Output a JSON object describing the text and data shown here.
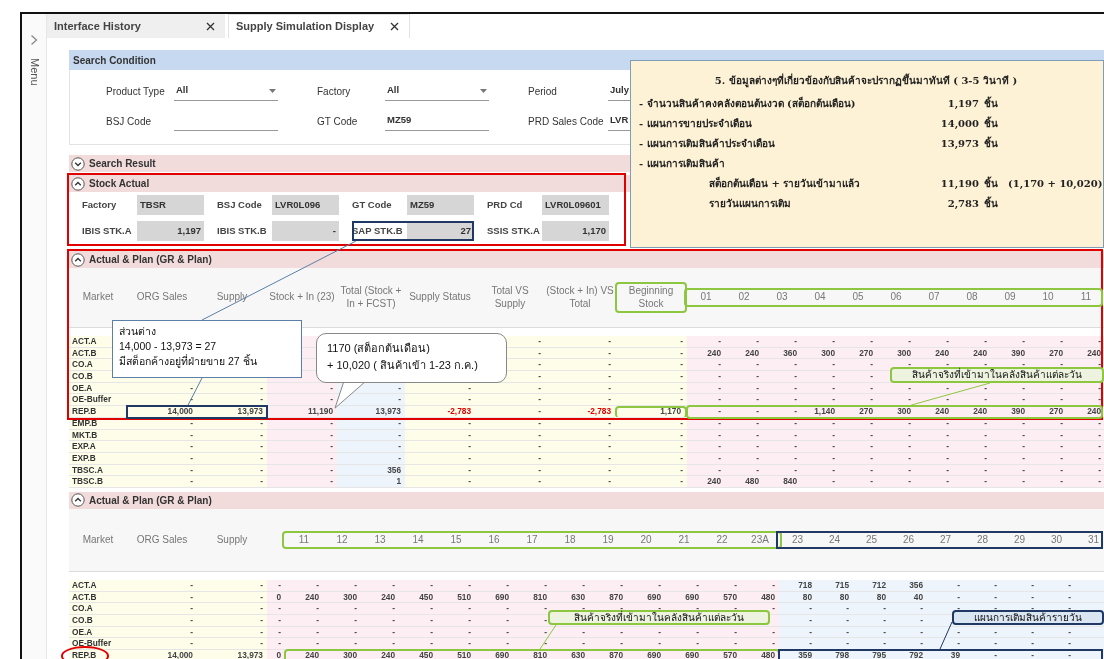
{
  "sidebar": {
    "menu_label": "Menu"
  },
  "tabs": [
    {
      "label": "Interface History",
      "selected": false
    },
    {
      "label": "Supply Simulation Display",
      "selected": true
    }
  ],
  "search_condition": {
    "title": "Search Condition",
    "fields": [
      {
        "label": "Product Type",
        "kind": "select",
        "value": "All"
      },
      {
        "label": "Factory",
        "kind": "select",
        "value": "All"
      },
      {
        "label": "Period",
        "kind": "text",
        "value": "July"
      },
      {
        "label": "BSJ Code",
        "kind": "text"
      },
      {
        "label": "GT Code",
        "kind": "text",
        "value": "MZ59"
      },
      {
        "label": "PRD Sales Code",
        "kind": "text",
        "value": "LVR"
      }
    ]
  },
  "search_result": {
    "title": "Search Result",
    "expanded": false
  },
  "stock_actual": {
    "title": "Stock Actual",
    "expanded": true,
    "fields": [
      {
        "label": "Factory",
        "kind": "code",
        "value": "TBSR"
      },
      {
        "label": "BSJ Code",
        "kind": "code",
        "value": "LVR0L096"
      },
      {
        "label": "GT Code",
        "kind": "code",
        "value": "MZ59"
      },
      {
        "label": "PRD Cd",
        "kind": "code",
        "value": "LVR0L09601"
      },
      {
        "label": "IBIS STK.A",
        "kind": "number",
        "value": "1,197"
      },
      {
        "label": "IBIS STK.B",
        "kind": "number",
        "value": "-"
      },
      {
        "label": "SAP STK.B",
        "kind": "number",
        "value": "27"
      },
      {
        "label": "SSIS STK.A",
        "kind": "number",
        "value": "1,170"
      }
    ]
  },
  "plan_tables": [
    {
      "title": "Actual & Plan (GR & Plan)",
      "expanded": true,
      "columns": [
        {
          "label": "Market",
          "kind": "market"
        },
        {
          "label": "ORG Sales",
          "kind": "number"
        },
        {
          "label": "Supply",
          "kind": "number"
        },
        {
          "label": "Stock + In (23)",
          "kind": "stock"
        },
        {
          "label": "Total (Stock + In + FCST)",
          "kind": "total"
        },
        {
          "label": "Supply Status",
          "kind": "number"
        },
        {
          "label": "Total VS Supply",
          "kind": "number"
        },
        {
          "label": "(Stock + In) VS Total",
          "kind": "number"
        },
        {
          "label": "Beginning Stock",
          "kind": "begin"
        },
        {
          "label": "01",
          "kind": "day"
        },
        {
          "label": "02",
          "kind": "day"
        },
        {
          "label": "03",
          "kind": "day"
        },
        {
          "label": "04",
          "kind": "day"
        },
        {
          "label": "05",
          "kind": "day"
        },
        {
          "label": "06",
          "kind": "day"
        },
        {
          "label": "07",
          "kind": "day"
        },
        {
          "label": "08",
          "kind": "day"
        },
        {
          "label": "09",
          "kind": "day"
        },
        {
          "label": "10",
          "kind": "day"
        },
        {
          "label": "11",
          "kind": "day"
        }
      ],
      "rows": [
        {
          "cells": [
            "ACT.A",
            null,
            null,
            null,
            null,
            null,
            "-",
            "-",
            "-",
            "-",
            "-",
            "-",
            "-",
            "-",
            "-",
            "-",
            "-",
            "-",
            "-",
            "-"
          ]
        },
        {
          "cells": [
            "ACT.B",
            null,
            null,
            null,
            null,
            null,
            "-",
            "-",
            "-",
            "240",
            "240",
            "360",
            "300",
            "270",
            "300",
            "240",
            "240",
            "390",
            "270",
            "240"
          ]
        },
        {
          "cells": [
            "CO.A",
            null,
            null,
            null,
            null,
            null,
            "-",
            "-",
            "-",
            "-",
            "-",
            "-",
            "-",
            "-",
            "-",
            "-",
            "-",
            "-",
            "-",
            "-"
          ]
        },
        {
          "cells": [
            "CO.B",
            null,
            null,
            null,
            null,
            null,
            "-",
            "-",
            "-",
            "-",
            "-",
            "-",
            "-",
            "-",
            null,
            null,
            null,
            null,
            null,
            null
          ]
        },
        {
          "cells": [
            "OE.A",
            "-",
            "-",
            "-",
            "-",
            "-",
            "-",
            "-",
            "-",
            "-",
            "-",
            "-",
            "-",
            "-",
            "-",
            "-",
            "-",
            "-",
            "-",
            "-"
          ]
        },
        {
          "cells": [
            "OE-Buffer",
            "-",
            "-",
            "-",
            "-",
            "-",
            "-",
            "-",
            "-",
            "-",
            "-",
            "-",
            "-",
            "-",
            "-",
            "-",
            "-",
            "-",
            "-",
            "-"
          ]
        },
        {
          "cells": [
            "REP.B",
            "14,000",
            "13,973",
            "11,190",
            "13,973",
            {
              "text": "-2,783",
              "alert": true
            },
            "-",
            {
              "text": "-2,783",
              "alert": true
            },
            "1,170",
            "-",
            "-",
            "-",
            "1,140",
            "270",
            "300",
            "240",
            "240",
            "390",
            "270",
            "240"
          ]
        },
        {
          "cells": [
            "EMP.B",
            "-",
            "-",
            "-",
            "-",
            "-",
            "-",
            "-",
            "-",
            "-",
            "-",
            "-",
            "-",
            "-",
            "-",
            "-",
            "-",
            "-",
            "-",
            "-"
          ]
        },
        {
          "cells": [
            "MKT.B",
            "-",
            "-",
            "-",
            "-",
            "-",
            "-",
            "-",
            "-",
            "-",
            "-",
            "-",
            "-",
            "-",
            "-",
            "-",
            "-",
            "-",
            "-",
            "-"
          ]
        },
        {
          "cells": [
            "EXP.A",
            "-",
            "-",
            "-",
            "-",
            "-",
            "-",
            "-",
            "-",
            "-",
            "-",
            "-",
            "-",
            "-",
            "-",
            "-",
            "-",
            "-",
            "-",
            "-"
          ]
        },
        {
          "cells": [
            "EXP.B",
            "-",
            "-",
            "-",
            "-",
            "-",
            "-",
            "-",
            "-",
            "-",
            "-",
            "-",
            "-",
            "-",
            "-",
            "-",
            "-",
            "-",
            "-",
            "-"
          ]
        },
        {
          "cells": [
            "TBSC.A",
            "-",
            "-",
            "-",
            "356",
            "-",
            "-",
            "-",
            "-",
            "-",
            "-",
            "-",
            "-",
            "-",
            "-",
            "-",
            "-",
            "-",
            "-",
            "-"
          ]
        },
        {
          "cells": [
            "TBSC.B",
            "-",
            "-",
            "-",
            "1",
            "-",
            "-",
            "-",
            "-",
            "240",
            "480",
            "840",
            "-",
            "-",
            "-",
            "-",
            "-",
            "-",
            "-",
            "-"
          ]
        }
      ]
    },
    {
      "title": "Actual & Plan (GR & Plan)",
      "expanded": true,
      "columns": [
        {
          "label": "Market",
          "kind": "market"
        },
        {
          "label": "ORG Sales",
          "kind": "number"
        },
        {
          "label": "Supply",
          "kind": "number"
        },
        {
          "kind": "partial"
        },
        {
          "label": "11",
          "kind": "day"
        },
        {
          "label": "12",
          "kind": "day"
        },
        {
          "label": "13",
          "kind": "day"
        },
        {
          "label": "14",
          "kind": "day"
        },
        {
          "label": "15",
          "kind": "day"
        },
        {
          "label": "16",
          "kind": "day"
        },
        {
          "label": "17",
          "kind": "day"
        },
        {
          "label": "18",
          "kind": "day"
        },
        {
          "label": "19",
          "kind": "day"
        },
        {
          "label": "20",
          "kind": "day"
        },
        {
          "label": "21",
          "kind": "day"
        },
        {
          "label": "22",
          "kind": "day"
        },
        {
          "label": "23A",
          "kind": "day"
        },
        {
          "label": "23",
          "kind": "plan"
        },
        {
          "label": "24",
          "kind": "plan"
        },
        {
          "label": "25",
          "kind": "plan"
        },
        {
          "label": "26",
          "kind": "plan"
        },
        {
          "label": "27",
          "kind": "plan"
        },
        {
          "label": "28",
          "kind": "plan"
        },
        {
          "label": "29",
          "kind": "plan"
        },
        {
          "label": "30",
          "kind": "plan"
        },
        {
          "label": "31",
          "kind": "plan"
        }
      ],
      "rows": [
        {
          "cells": [
            "ACT.A",
            "-",
            "-",
            "-",
            "-",
            "-",
            "-",
            "-",
            "-",
            "-",
            "-",
            "-",
            "-",
            "-",
            "-",
            "-",
            "-",
            "718",
            "715",
            "712",
            "356",
            "-",
            "-",
            "-",
            "-",
            null
          ]
        },
        {
          "cells": [
            "ACT.B",
            "-",
            "-",
            "0",
            "240",
            "300",
            "240",
            "450",
            "510",
            "690",
            "810",
            "630",
            "870",
            "690",
            "690",
            "570",
            "480",
            "80",
            "80",
            "80",
            "40",
            "-",
            "-",
            "-",
            "-",
            null
          ]
        },
        {
          "cells": [
            "CO.A",
            "-",
            "-",
            "-",
            "-",
            "-",
            "-",
            "-",
            "-",
            "-",
            "-",
            "-",
            "-",
            "-",
            "-",
            "-",
            "-",
            "-",
            "-",
            "-",
            "-",
            "-",
            "-",
            "-",
            "-",
            null
          ]
        },
        {
          "cells": [
            "CO.B",
            "-",
            "-",
            "-",
            "-",
            "-",
            "-",
            "-",
            "-",
            "-",
            "-",
            null,
            null,
            null,
            null,
            null,
            null,
            "-",
            "-",
            "-",
            "-",
            null,
            null,
            null,
            null,
            null
          ]
        },
        {
          "cells": [
            "OE.A",
            "-",
            "-",
            "-",
            "-",
            "-",
            "-",
            "-",
            "-",
            "-",
            "-",
            "-",
            "-",
            "-",
            "-",
            "-",
            "-",
            "-",
            "-",
            "-",
            "-",
            "-",
            "-",
            "-",
            "-",
            null
          ]
        },
        {
          "cells": [
            "OE-Buffer",
            "-",
            "-",
            "-",
            "-",
            "-",
            "-",
            "-",
            "-",
            "-",
            "-",
            "-",
            "-",
            "-",
            "-",
            "-",
            "-",
            "-",
            "-",
            "-",
            "-",
            "-",
            "-",
            "-",
            "-",
            null
          ]
        },
        {
          "cells": [
            "REP.B",
            "14,000",
            "13,973",
            "0",
            "240",
            "300",
            "240",
            "450",
            "510",
            "690",
            "810",
            "630",
            "870",
            "690",
            "690",
            "570",
            "480",
            "359",
            "798",
            "795",
            "792",
            "39",
            "-",
            "-",
            "-",
            null
          ]
        }
      ]
    }
  ],
  "info_panel": {
    "title": "5. ข้อมูลต่างๆที่เกี่ยวข้องกับสินค้าจะปรากฏขึ้นมาทันที ( 3-5 วินาที )",
    "items": [
      {
        "kind": "main",
        "label": "- จำนวนสินค้าคงคลังตอนต้นงวด (สต็อกต้นเดือน)",
        "value": "1,197",
        "unit": "ชิ้น"
      },
      {
        "kind": "main",
        "label": "- แผนการขายประจำเดือน",
        "value": "14,000",
        "unit": "ชิ้น"
      },
      {
        "kind": "main",
        "label": "- แผนการเติมสินค้าประจำเดือน",
        "value": "13,973",
        "unit": "ชิ้น"
      },
      {
        "kind": "main",
        "label": "- แผนการเติมสินค้า"
      },
      {
        "kind": "sub",
        "label": "สต็อกต้นเดือน + รายวันเข้ามาแล้ว",
        "value": "11,190",
        "unit": "ชิ้น",
        "detail": "(1,170 + 10,020)"
      },
      {
        "kind": "sub",
        "label": "รายวันแผนการเติม",
        "value": "2,783",
        "unit": "ชิ้น"
      }
    ]
  },
  "callouts": [
    {
      "kind": "note",
      "lines": [
        "ส่วนต่าง",
        "14,000 - 13,973 = 27",
        "มีสต็อกค้างอยู่ที่ฝ่ายขาย 27 ชิ้น"
      ]
    },
    {
      "kind": "bubble",
      "lines": [
        "1170 (สต็อกต้นเดือน)",
        "+ 10,020 ( สินค้าเข้า 1-23 ก.ค.)"
      ]
    },
    {
      "kind": "tag",
      "text": "สินค้าจริงที่เข้ามาในคลังสินค้าแต่ละวัน",
      "color": "#8dc63f"
    },
    {
      "kind": "tag",
      "text": "สินค้าจริงที่เข้ามาในคลังสินค้าแต่ละวัน",
      "color": "#8dc63f"
    },
    {
      "kind": "tag",
      "text": "แผนการเติมสินค้ารายวัน",
      "color": "#1f3864"
    }
  ]
}
